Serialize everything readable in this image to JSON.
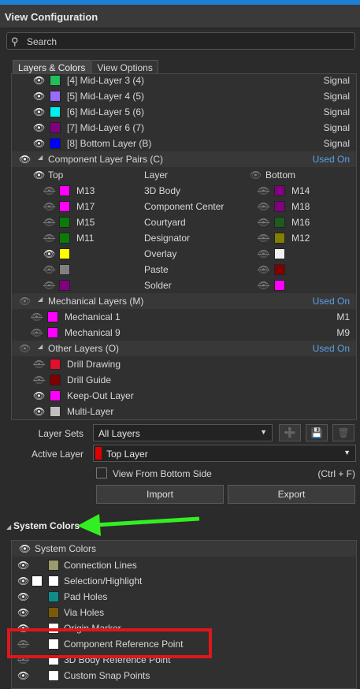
{
  "window": {
    "title": "View Configuration"
  },
  "search": {
    "placeholder": "Search"
  },
  "tabs": [
    {
      "label": "Layers & Colors"
    },
    {
      "label": "View Options"
    }
  ],
  "signal_layers": [
    {
      "label": "[4] Mid-Layer 3 (4)",
      "type": "Signal",
      "color": "#1fbf5a",
      "visible": true
    },
    {
      "label": "[5] Mid-Layer 4 (5)",
      "type": "Signal",
      "color": "#9a6bff",
      "visible": true
    },
    {
      "label": "[6] Mid-Layer 5 (6)",
      "type": "Signal",
      "color": "#00f0f0",
      "visible": true
    },
    {
      "label": "[7] Mid-Layer 6 (7)",
      "type": "Signal",
      "color": "#800080",
      "visible": true
    },
    {
      "label": "[8] Bottom Layer (B)",
      "type": "Signal",
      "color": "#0000ff",
      "visible": true
    }
  ],
  "component_pairs": {
    "header": "Component Layer Pairs (C)",
    "used_on": "Used On",
    "col_top": "Top",
    "col_layer": "Layer",
    "col_bottom": "Bottom",
    "rows": [
      {
        "top_color": "#ff00ff",
        "top_label": "M13",
        "layer": "3D Body",
        "bottom_color": "#800080",
        "bottom_label": "M14",
        "top_visible": false
      },
      {
        "top_color": "#ff00ff",
        "top_label": "M17",
        "layer": "Component Center",
        "bottom_color": "#800080",
        "bottom_label": "M18",
        "top_visible": false
      },
      {
        "top_color": "#0a7a0a",
        "top_label": "M15",
        "layer": "Courtyard",
        "bottom_color": "#1f5a1f",
        "bottom_label": "M16",
        "top_visible": false
      },
      {
        "top_color": "#0a7a0a",
        "top_label": "M11",
        "layer": "Designator",
        "bottom_color": "#808000",
        "bottom_label": "M12",
        "top_visible": false
      },
      {
        "top_color": "#ffff00",
        "top_label": "",
        "layer": "Overlay",
        "bottom_color": "#f0f0f0",
        "bottom_label": "",
        "top_visible": true
      },
      {
        "top_color": "#808080",
        "top_label": "",
        "layer": "Paste",
        "bottom_color": "#800000",
        "bottom_label": "",
        "top_visible": false
      },
      {
        "top_color": "#800080",
        "top_label": "",
        "layer": "Solder",
        "bottom_color": "#ff00ff",
        "bottom_label": "",
        "top_visible": false
      }
    ]
  },
  "mechanical": {
    "header": "Mechanical Layers (M)",
    "used_on": "Used On",
    "rows": [
      {
        "label": "Mechanical 1",
        "code": "M1",
        "color": "#ff00ff"
      },
      {
        "label": "Mechanical 9",
        "code": "M9",
        "color": "#ff00ff"
      }
    ]
  },
  "other": {
    "header": "Other Layers (O)",
    "used_on": "Used On",
    "rows": [
      {
        "label": "Drill Drawing",
        "color": "#e0102a",
        "visible": false
      },
      {
        "label": "Drill Guide",
        "color": "#800000",
        "visible": false
      },
      {
        "label": "Keep-Out Layer",
        "color": "#ff00ff",
        "visible": true
      },
      {
        "label": "Multi-Layer",
        "color": "#c0c0c0",
        "visible": true
      }
    ]
  },
  "controls": {
    "layer_sets_label": "Layer Sets",
    "layer_sets_value": "All Layers",
    "active_layer_label": "Active Layer",
    "active_layer_value": "Top Layer",
    "active_layer_color": "#e00000",
    "view_bottom_label": "View From Bottom Side",
    "view_bottom_shortcut": "(Ctrl + F)",
    "import_label": "Import",
    "export_label": "Export"
  },
  "system_colors": {
    "section_title": "System Colors",
    "header": "System Colors",
    "rows": [
      {
        "label": "Connection Lines",
        "color": "#9a9a6a",
        "visible": true,
        "extra": false
      },
      {
        "label": "Selection/Highlight",
        "color": "#ffffff",
        "visible": true,
        "extra": true
      },
      {
        "label": "Pad Holes",
        "color": "#138a8a",
        "visible": true,
        "extra": false
      },
      {
        "label": "Via Holes",
        "color": "#7a5a0a",
        "visible": true,
        "extra": false
      },
      {
        "label": "Origin Marker",
        "color": "#ffffff",
        "visible": true,
        "extra": false
      },
      {
        "label": "Component Reference Point",
        "color": "#ffffff",
        "visible": false,
        "extra": false
      },
      {
        "label": "3D Body Reference Point",
        "color": "#ffffff",
        "visible": false,
        "extra": false
      },
      {
        "label": "Custom Snap Points",
        "color": "#ffffff",
        "visible": true,
        "extra": false
      }
    ]
  },
  "accent_colors": {
    "used_on": "#5aa0e8",
    "highlight_box": "#e0161b",
    "arrow": "#33ee22"
  }
}
